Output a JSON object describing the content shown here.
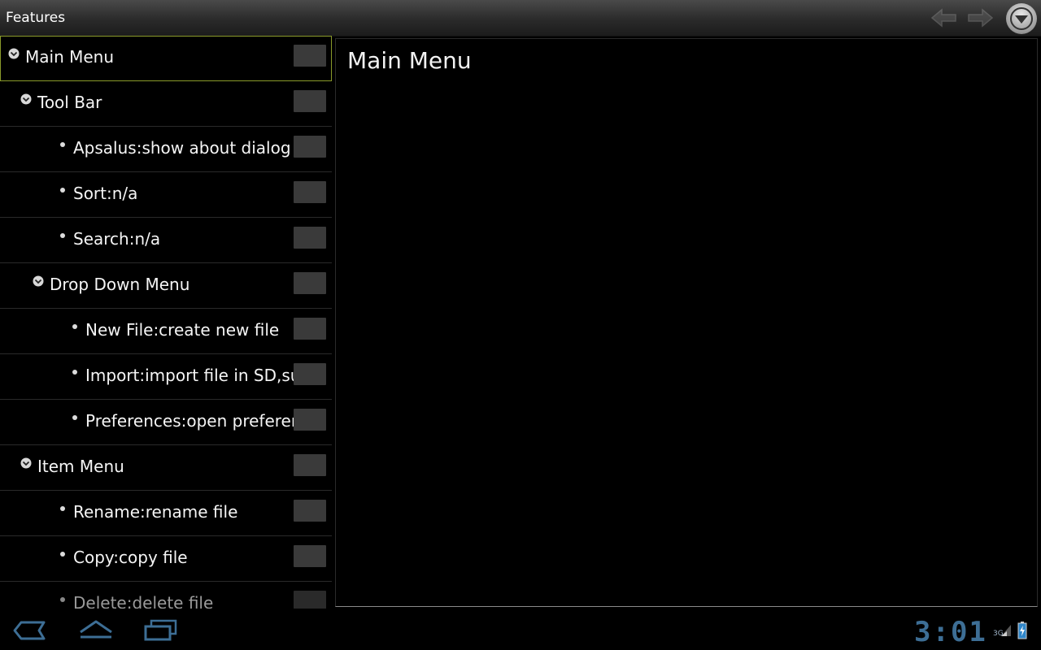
{
  "action_bar": {
    "title": "Features"
  },
  "feature_list": {
    "items": [
      {
        "label": "Main Menu",
        "level": 0,
        "type": "group",
        "checked": false,
        "selected": true
      },
      {
        "label": "Tool Bar",
        "level": 1,
        "type": "group",
        "checked": false
      },
      {
        "label": "Apsalus:show about dialog",
        "level": 2,
        "type": "item",
        "checked": false
      },
      {
        "label": "Sort:n/a",
        "level": 2,
        "type": "item",
        "checked": false
      },
      {
        "label": "Search:n/a",
        "level": 2,
        "type": "item",
        "checked": false
      },
      {
        "label": "Drop Down Menu",
        "level": 2,
        "type": "group",
        "checked": false
      },
      {
        "label": "New File:create new file",
        "level": 3,
        "type": "item",
        "checked": false
      },
      {
        "label": "Import:import file in SD,sup...",
        "level": 3,
        "type": "item",
        "checked": false
      },
      {
        "label": "Preferences:open preferenc...",
        "level": 3,
        "type": "item",
        "checked": false
      },
      {
        "label": "Item Menu",
        "level": 1,
        "type": "group",
        "checked": false
      },
      {
        "label": "Rename:rename file",
        "level": 2,
        "type": "item",
        "checked": false
      },
      {
        "label": "Copy:copy file",
        "level": 2,
        "type": "item",
        "checked": false
      },
      {
        "label": "Delete:delete file",
        "level": 2,
        "type": "item",
        "checked": false,
        "faded": true
      }
    ]
  },
  "detail": {
    "title": "Main Menu"
  },
  "system_bar": {
    "clock": "3:01",
    "network": "3G"
  },
  "colors": {
    "selection_outline": "#8a9a2a",
    "clock": "#3d6e95",
    "checkbox": "#3a3a3a"
  }
}
